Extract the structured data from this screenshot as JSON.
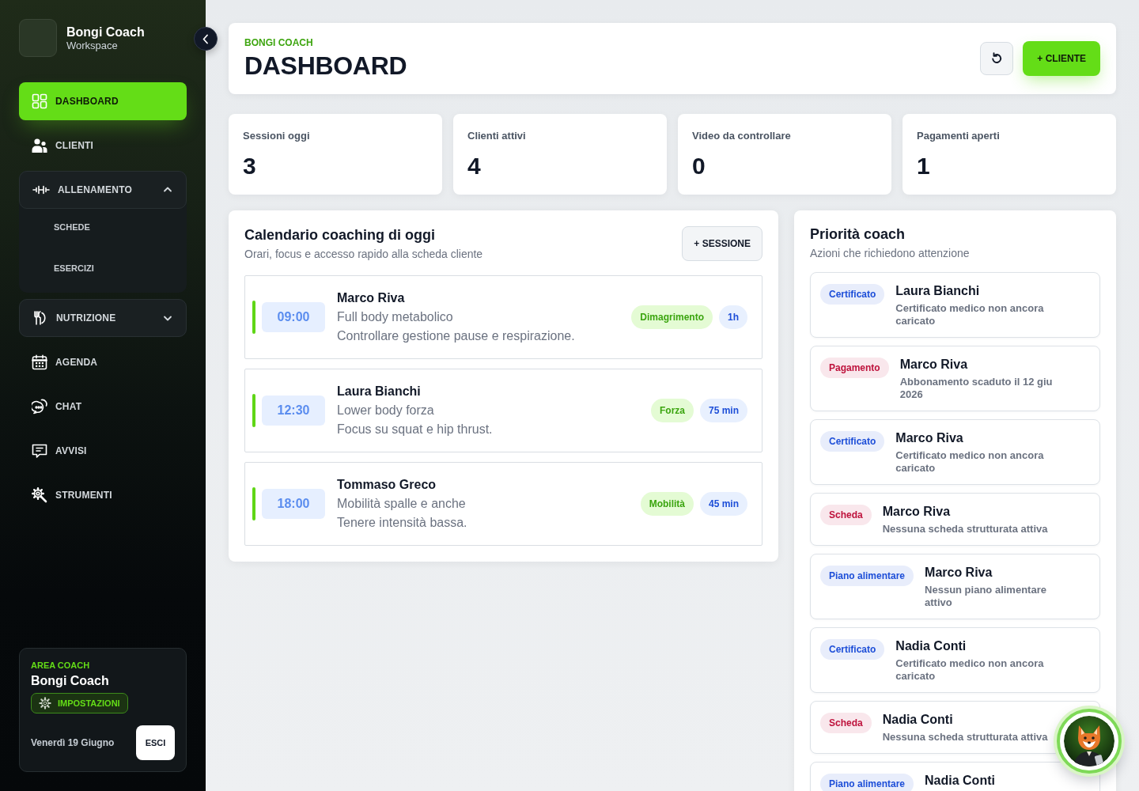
{
  "sidebar": {
    "brand": {
      "title": "Bongi Coach",
      "subtitle": "Workspace"
    },
    "nav": [
      {
        "kind": "link",
        "label": "DASHBOARD",
        "selected": true
      },
      {
        "kind": "link",
        "label": "CLIENTI",
        "selected": false
      },
      {
        "kind": "group",
        "label": "ALLENAMENTO",
        "selected": false,
        "expanded": true,
        "children": [
          {
            "label": "SCHEDE",
            "selected": false
          },
          {
            "label": "ESERCIZI",
            "selected": false
          }
        ]
      },
      {
        "kind": "group",
        "label": "NUTRIZIONE",
        "selected": false,
        "expanded": false
      },
      {
        "kind": "link",
        "label": "AGENDA",
        "selected": false
      },
      {
        "kind": "link",
        "label": "CHAT",
        "selected": false
      },
      {
        "kind": "link",
        "label": "AVVISI",
        "selected": false
      },
      {
        "kind": "link",
        "label": "STRUMENTI",
        "selected": false
      }
    ],
    "footer": {
      "eyebrow": "AREA COACH",
      "name": "Bongi Coach",
      "settings_button": "IMPOSTAZIONI",
      "date": "Venerdì 19 Giugno",
      "logout_button": "ESCI"
    }
  },
  "header": {
    "eyebrow": "BONGI COACH",
    "title": "DASHBOARD",
    "new_client_button": "+ CLIENTE"
  },
  "stats": [
    {
      "label": "Sessioni oggi",
      "value": "3"
    },
    {
      "label": "Clienti attivi",
      "value": "4"
    },
    {
      "label": "Video da controllare",
      "value": "0"
    },
    {
      "label": "Pagamenti aperti",
      "value": "1"
    }
  ],
  "calendar": {
    "title": "Calendario coaching di oggi",
    "subtitle": "Orari, focus e accesso rapido alla scheda cliente",
    "add_button": "+ SESSIONE",
    "sessions": [
      {
        "time": "09:00",
        "client": "Marco Riva",
        "workout": "Full body metabolico",
        "note": "Controllare gestione pause e respirazione.",
        "category": "Dimagrimento",
        "duration": "1h"
      },
      {
        "time": "12:30",
        "client": "Laura Bianchi",
        "workout": "Lower body forza",
        "note": "Focus su squat e hip thrust.",
        "category": "Forza",
        "duration": "75 min"
      },
      {
        "time": "18:00",
        "client": "Tommaso Greco",
        "workout": "Mobilità spalle e anche",
        "note": "Tenere intensità bassa.",
        "category": "Mobilità",
        "duration": "45 min"
      }
    ]
  },
  "priorities": {
    "title": "Priorità coach",
    "subtitle": "Azioni che richiedono attenzione",
    "items": [
      {
        "tag": "Certificato",
        "color": "#1d4ed8",
        "client": "Laura Bianchi",
        "message": "Certificato medico non ancora caricato"
      },
      {
        "tag": "Pagamento",
        "color": "#be123c",
        "client": "Marco Riva",
        "message": "Abbonamento scaduto il 12 giu 2026"
      },
      {
        "tag": "Certificato",
        "color": "#1d4ed8",
        "client": "Marco Riva",
        "message": "Certificato medico non ancora caricato"
      },
      {
        "tag": "Scheda",
        "color": "#be123c",
        "client": "Marco Riva",
        "message": "Nessuna scheda strutturata attiva"
      },
      {
        "tag": "Piano alimentare",
        "color": "#1d4ed8",
        "client": "Marco Riva",
        "message": "Nessun piano alimentare attivo"
      },
      {
        "tag": "Certificato",
        "color": "#1d4ed8",
        "client": "Nadia Conti",
        "message": "Certificato medico non ancora caricato"
      },
      {
        "tag": "Scheda",
        "color": "#be123c",
        "client": "Nadia Conti",
        "message": "Nessuna scheda strutturata attiva"
      },
      {
        "tag": "Piano alimentare",
        "color": "#1d4ed8",
        "client": "Nadia Conti"
      }
    ]
  }
}
